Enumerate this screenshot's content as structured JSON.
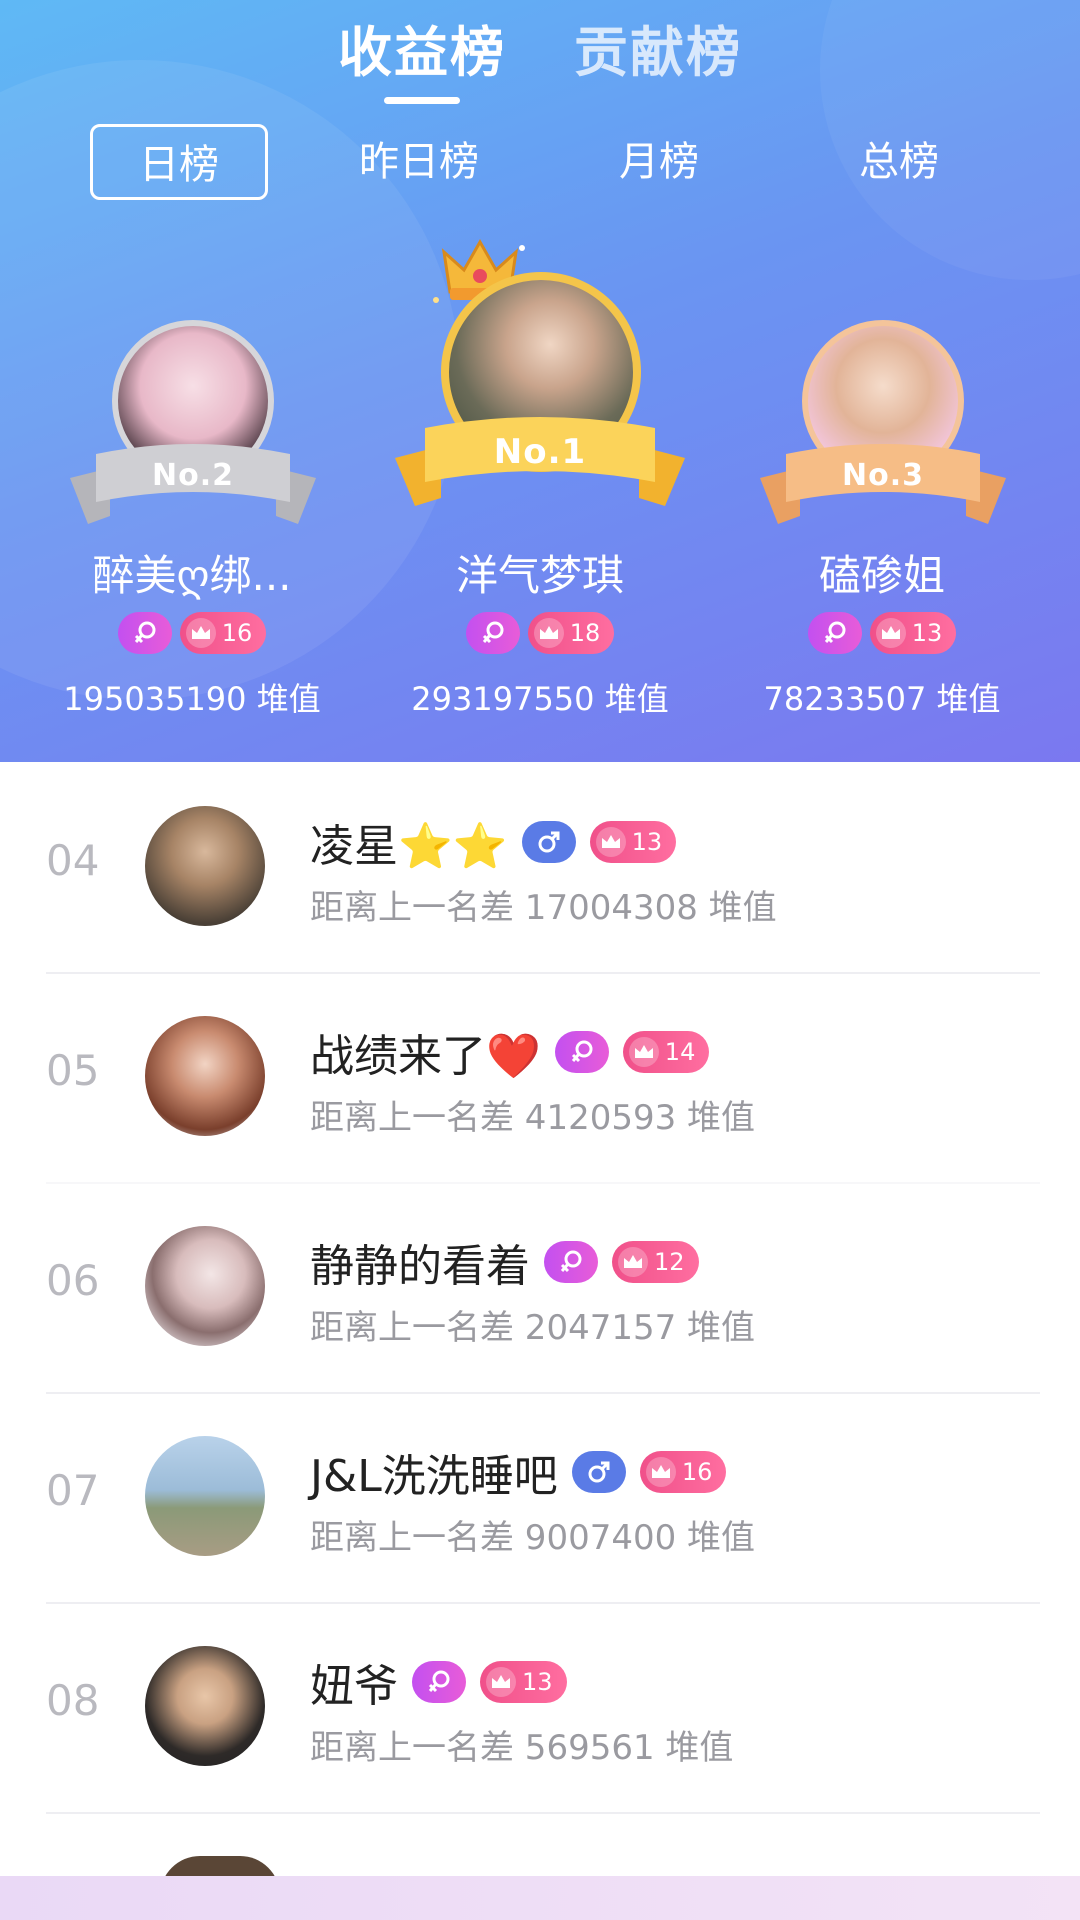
{
  "tabs": {
    "main": [
      "收益榜",
      "贡献榜"
    ],
    "sub": [
      "日榜",
      "昨日榜",
      "月榜",
      "总榜"
    ]
  },
  "top3": [
    {
      "rank_label": "No.1",
      "name": "洋气梦琪",
      "gender": "female",
      "level": "18",
      "score": "293197550 堆值"
    },
    {
      "rank_label": "No.2",
      "name": "醉美ღ绑...",
      "gender": "female",
      "level": "16",
      "score": "195035190 堆值"
    },
    {
      "rank_label": "No.3",
      "name": "磕碜姐",
      "gender": "female",
      "level": "13",
      "score": "78233507 堆值"
    }
  ],
  "list": [
    {
      "rank": "04",
      "name": "凌星⭐⭐",
      "gender": "male",
      "level": "13",
      "gap": "距离上一名差 17004308 堆值"
    },
    {
      "rank": "05",
      "name": "战绩来了❤️",
      "gender": "female",
      "level": "14",
      "gap": "距离上一名差 4120593 堆值"
    },
    {
      "rank": "06",
      "name": "静静的看着",
      "gender": "female",
      "level": "12",
      "gap": "距离上一名差 2047157 堆值"
    },
    {
      "rank": "07",
      "name": "J&L洗洗睡吧",
      "gender": "male",
      "level": "16",
      "gap": "距离上一名差 9007400 堆值"
    },
    {
      "rank": "08",
      "name": "妞爷",
      "gender": "female",
      "level": "13",
      "gap": "距离上一名差 569561 堆值"
    }
  ],
  "icons": {
    "female": "female-symbol-icon",
    "male": "male-symbol-icon",
    "level": "crown-level-icon",
    "top_crown": "gold-crown-icon"
  },
  "colors": {
    "header_gradient": [
      "#5fb9f5",
      "#7b78f0"
    ],
    "gold": "#f7c646",
    "silver": "#c9c9cc",
    "bronze": "#f2b27a",
    "female_badge": "#c350f0",
    "male_badge": "#5a7be6",
    "level_badge": "#f0508a"
  }
}
